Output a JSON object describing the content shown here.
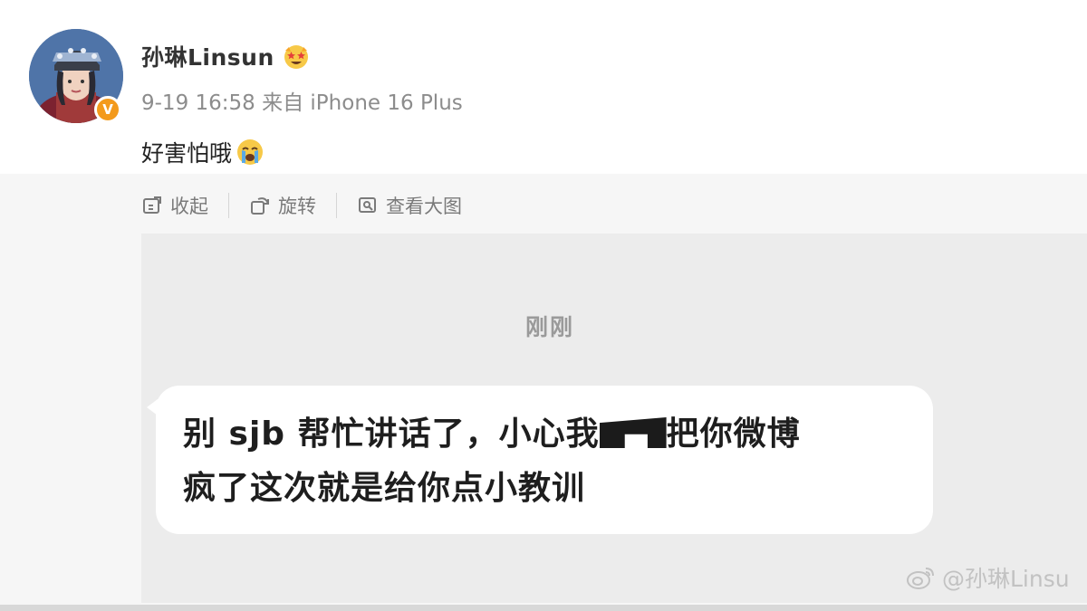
{
  "post": {
    "username": "孙琳Linsun",
    "user_emoji": "star-struck-emoji",
    "meta": "9-19 16:58 来自 iPhone 16 Plus",
    "text": "好害怕哦",
    "text_emoji": "crying-emoji",
    "verified_badge": "V"
  },
  "toolbar": {
    "collapse_label": "收起",
    "rotate_label": "旋转",
    "view_large_label": "查看大图"
  },
  "chat_image": {
    "time_label": "刚刚",
    "message_part1": "别 sjb 帮忙讲话了，小心我",
    "message_part2": "把你微博",
    "message_line2": "疯了这次就是给你点小教训"
  },
  "watermark": {
    "text": "@孙琳Linsu"
  },
  "colors": {
    "accent_badge": "#f39a1c",
    "text_primary": "#222222",
    "text_meta": "#8c8c8c",
    "panel_bg": "#ececec"
  }
}
